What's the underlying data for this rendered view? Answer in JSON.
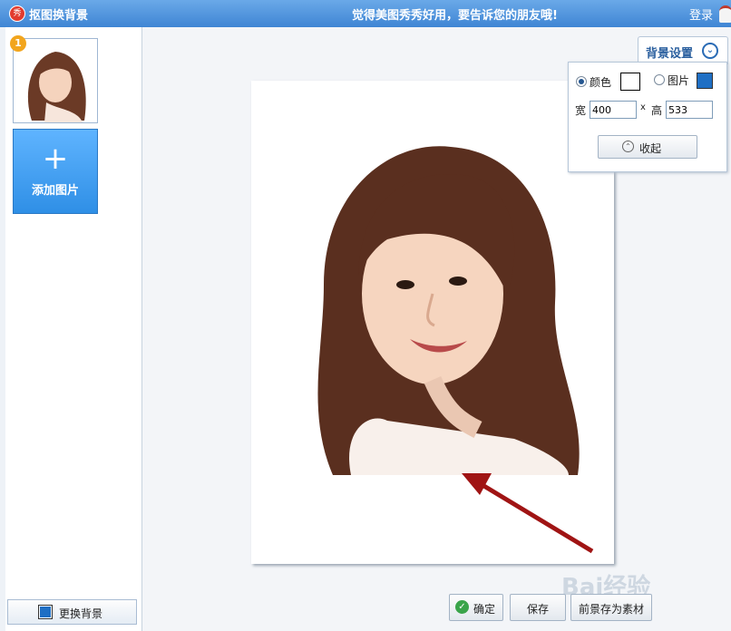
{
  "titlebar": {
    "app_title": "抠图换背景",
    "slogan": "觉得美图秀秀好用，要告诉您的朋友哦!",
    "login": "登录",
    "logo_text": "秀"
  },
  "sidebar": {
    "thumbnail_badge": "1",
    "add_label": "添加图片",
    "add_icon": "+",
    "change_bg_label": "更换背景"
  },
  "settings": {
    "tab_label": "背景设置",
    "color_label": "颜色",
    "image_label": "图片",
    "width_label": "宽",
    "width_value": "400",
    "times": "x",
    "height_label": "高",
    "height_value": "533",
    "collapse_label": "收起",
    "selected": "颜色",
    "swatch_color": "#ffffff"
  },
  "buttons": {
    "ok": "确定",
    "save": "保存",
    "save_as_material": "前景存为素材"
  },
  "watermark": {
    "text": "Bai经验"
  },
  "colors": {
    "titlebar": "#3f85d4",
    "add_button": "#2f8fe6",
    "arrow": "#a01414"
  }
}
